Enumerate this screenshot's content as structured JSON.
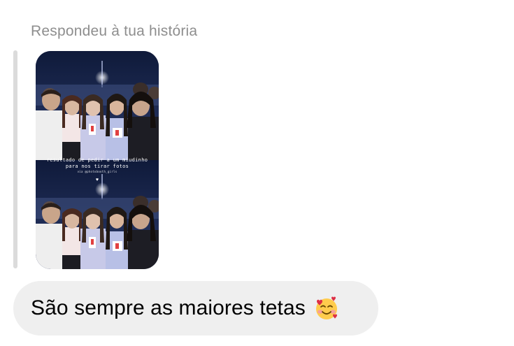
{
  "reply": {
    "label": "Respondeu à tua história"
  },
  "story": {
    "caption_line1": "resultado de pedir a um miudinho",
    "caption_line2": "para nos tirar fotos",
    "caption_small": "via @photobooth_girls",
    "heart": "♥"
  },
  "message": {
    "text": "São sempre as maiores tetas",
    "emoji_name": "smiling-face-with-hearts-icon"
  },
  "colors": {
    "bubble": "#efefef",
    "label": "#8e8e8e",
    "reply_bar": "#dbdbdb"
  }
}
